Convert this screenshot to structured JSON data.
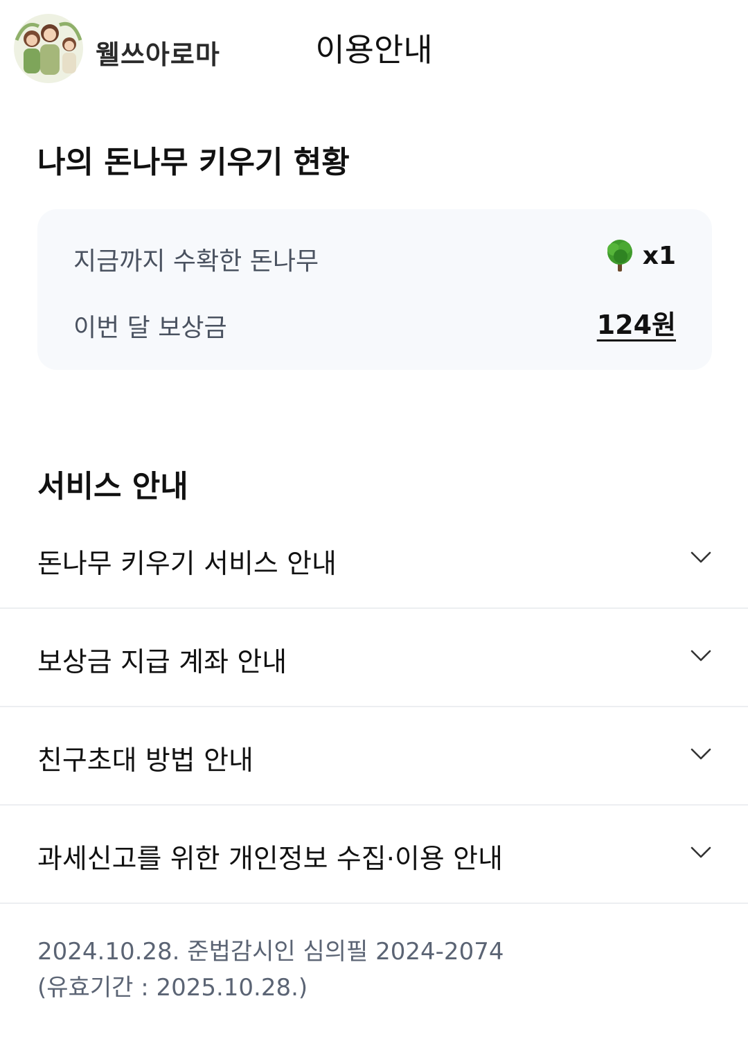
{
  "header": {
    "logo_text": "웰쓰아로마",
    "title": "이용안내"
  },
  "status": {
    "title": "나의 돈나무 키우기 현황",
    "harvested_label": "지금까지 수확한 돈나무",
    "harvested_icon": "tree-icon",
    "harvested_count": "x1",
    "reward_label": "이번 달 보상금",
    "reward_value": "124원"
  },
  "service": {
    "title": "서비스 안내",
    "items": [
      {
        "label": "돈나무 키우기 서비스 안내",
        "icon": "chevron-down-icon"
      },
      {
        "label": "보상금 지급 계좌 안내",
        "icon": "chevron-down-icon"
      },
      {
        "label": "친구초대 방법 안내",
        "icon": "chevron-down-icon"
      },
      {
        "label": "과세신고를 위한 개인정보 수집·이용 안내",
        "icon": "chevron-down-icon"
      }
    ]
  },
  "footer": {
    "line1": "2024.10.28. 준법감시인 심의필 2024-2074",
    "line2": "(유효기간 : 2025.10.28.)"
  },
  "colors": {
    "card_bg": "#f7f9fc",
    "divider": "#eceef1",
    "label_gray": "#4a5260",
    "footer_gray": "#5b6474",
    "tree_green": "#3f9a2c"
  }
}
